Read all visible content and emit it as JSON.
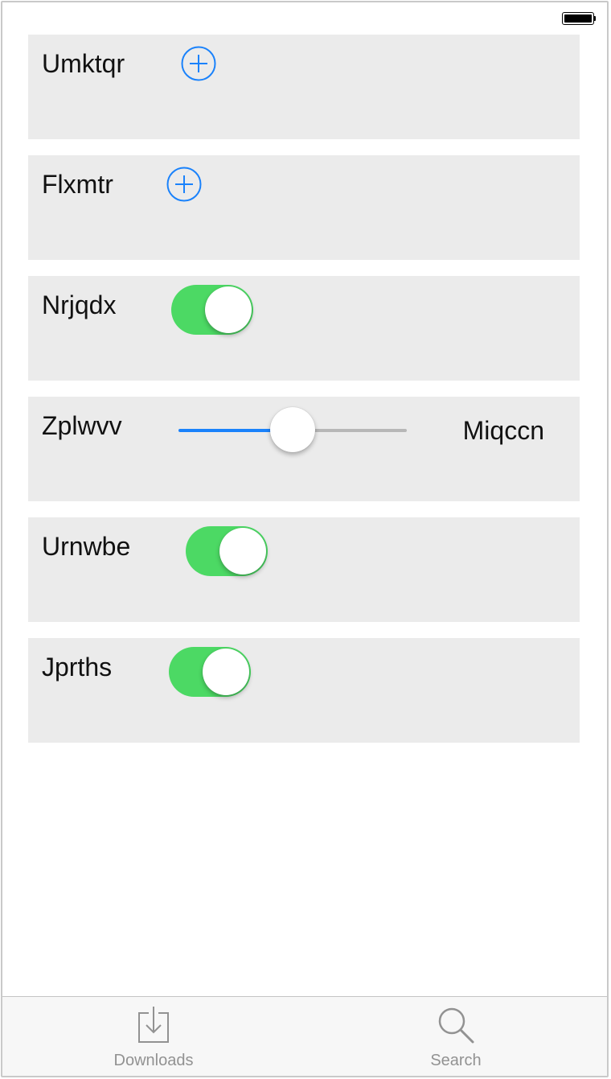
{
  "colors": {
    "accent": "#1a82fb",
    "toggle_on": "#4cd964",
    "row_background": "#ebebeb",
    "tab_inactive": "#929292"
  },
  "rows": [
    {
      "label": "Umktqr",
      "control": "add-button",
      "icon": "plus-circle-icon"
    },
    {
      "label": "Flxmtr",
      "control": "add-button",
      "icon": "plus-circle-icon"
    },
    {
      "label": "Nrjqdx",
      "control": "toggle",
      "on": true
    },
    {
      "label": "Zplwvv",
      "control": "slider",
      "max_label": "Miqccn",
      "value": 0.5
    },
    {
      "label": "Urnwbe",
      "control": "toggle",
      "on": true
    },
    {
      "label": "Jprths",
      "control": "toggle",
      "on": true
    }
  ],
  "tab_bar": {
    "tabs": [
      {
        "label": "Downloads",
        "icon": "downloads-icon"
      },
      {
        "label": "Search",
        "icon": "search-icon"
      }
    ]
  }
}
